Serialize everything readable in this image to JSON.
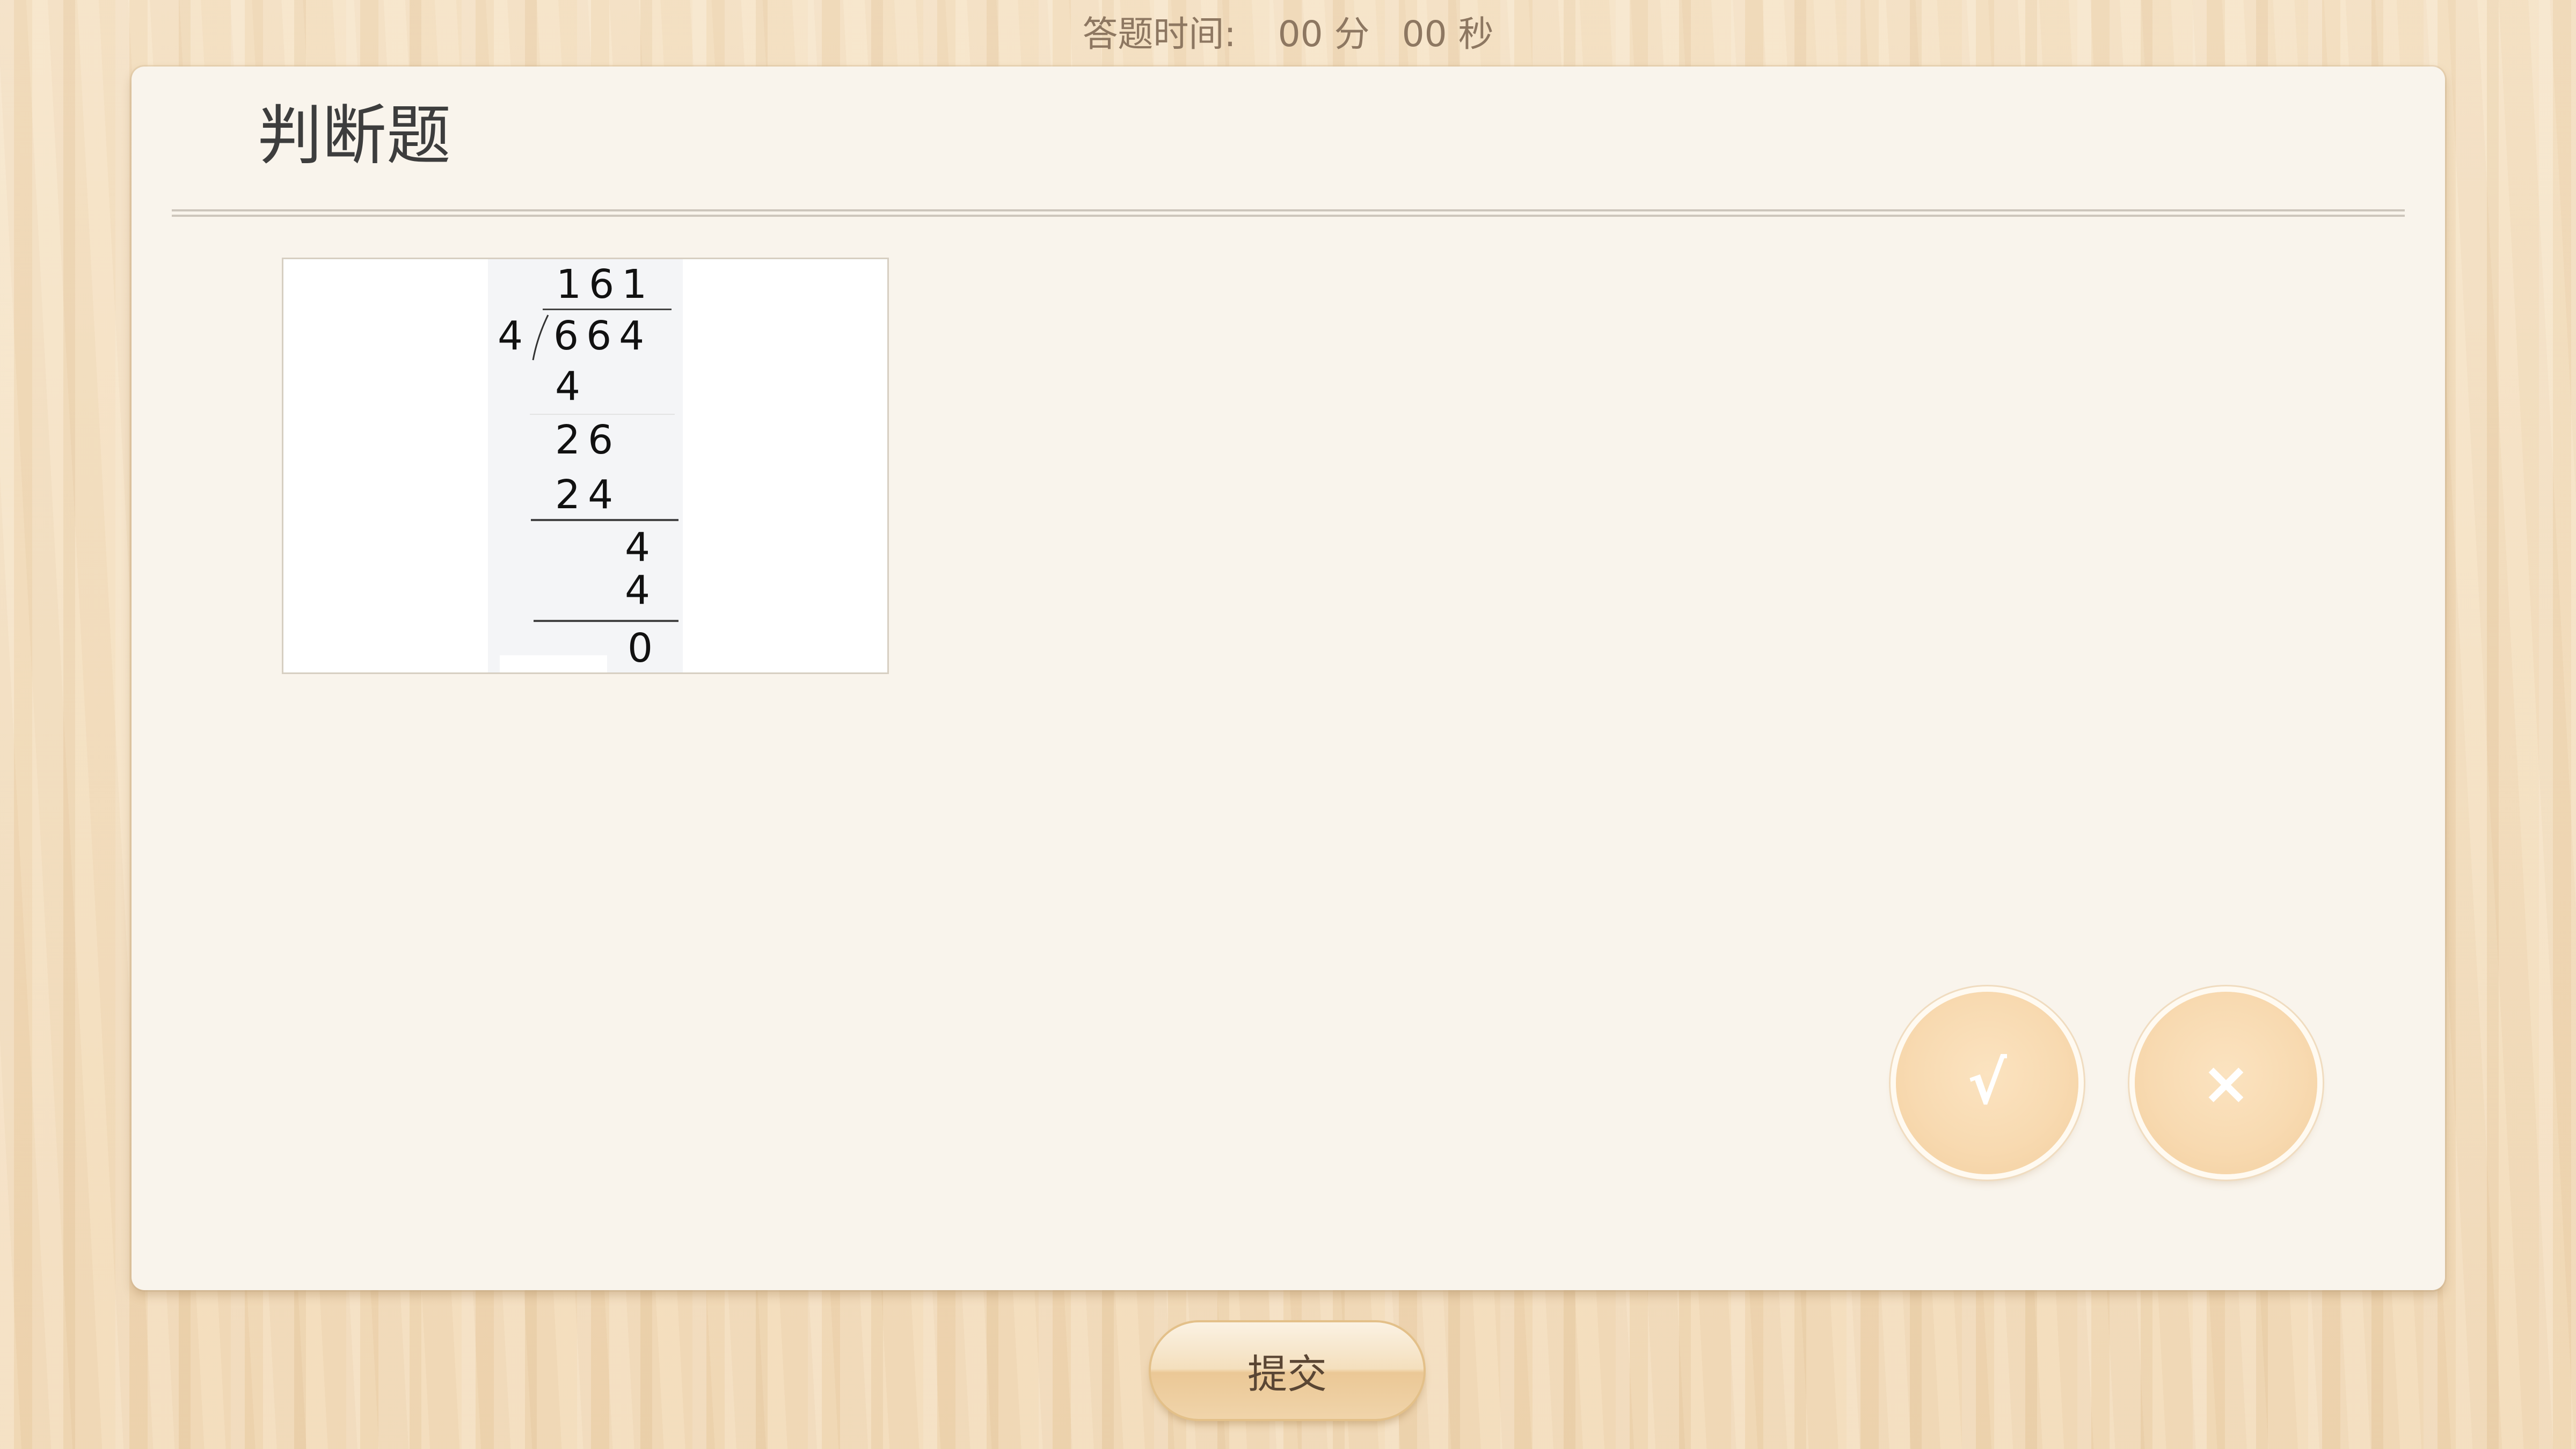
{
  "timer": {
    "label": "答题时间:",
    "minutes": "00",
    "minutes_unit": "分",
    "seconds": "00",
    "seconds_unit": "秒"
  },
  "question": {
    "type_title": "判断题",
    "long_division": {
      "quotient": "161",
      "divisor": "4",
      "dividend": "664",
      "steps": [
        "4",
        "26",
        "24",
        "4",
        "4"
      ],
      "remainder": "0"
    }
  },
  "answers": {
    "true_symbol": "√",
    "false_symbol": "×"
  },
  "submit_label": "提交",
  "colors": {
    "background": "#f2dcbc",
    "card": "#f9f4ec",
    "answer_button": "#f8dab1",
    "timer_text": "#8d7761"
  }
}
